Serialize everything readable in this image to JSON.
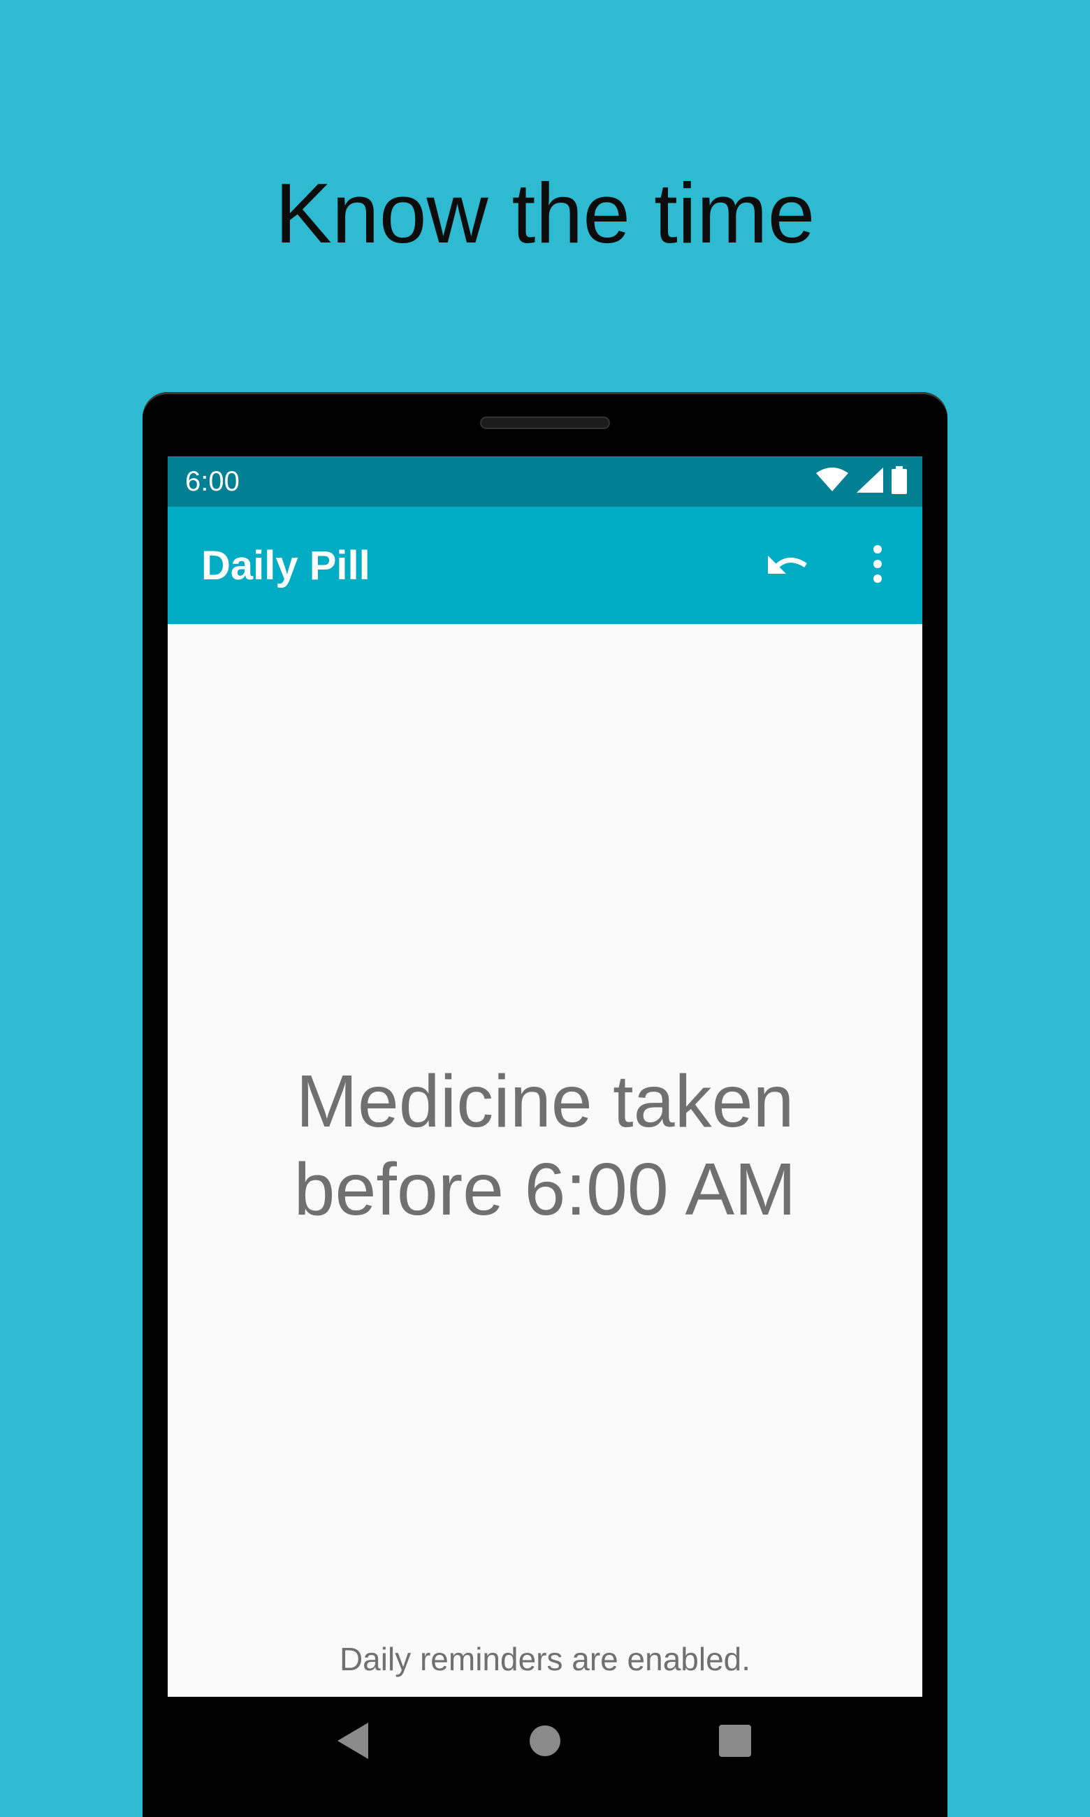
{
  "promo": {
    "headline": "Know the time"
  },
  "status_bar": {
    "time": "6:00",
    "icons": [
      "wifi-icon",
      "cellular-signal-icon",
      "battery-icon"
    ]
  },
  "app_bar": {
    "title": "Daily Pill",
    "actions": [
      "undo-icon",
      "more-vert-icon"
    ]
  },
  "main": {
    "message_line1": "Medicine taken",
    "message_line2": "before 6:00 AM",
    "footer": "Daily reminders are enabled."
  },
  "nav_bar": {
    "buttons": [
      "back-icon",
      "home-icon",
      "recents-icon"
    ]
  },
  "colors": {
    "background": "#2ebbd1",
    "status_bar": "#017f93",
    "app_bar": "#00acc4",
    "screen": "#fafafa",
    "text_gray": "#707070"
  }
}
